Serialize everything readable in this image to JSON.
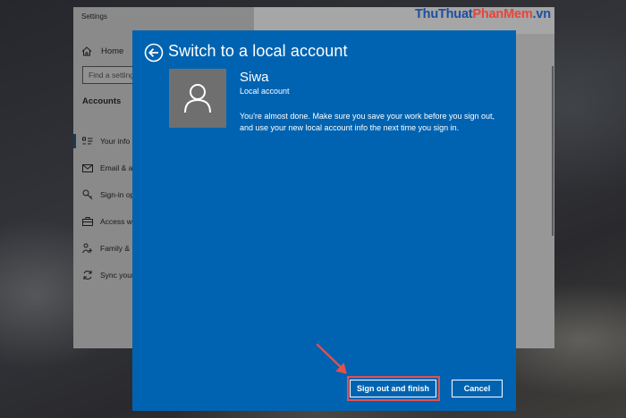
{
  "watermark": {
    "part1": "ThuThuat",
    "part2": "PhanMem",
    "part3": ".vn"
  },
  "settings": {
    "window_title": "Settings",
    "home_label": "Home",
    "search_placeholder": "Find a setting",
    "section_heading": "Accounts",
    "nav_items": [
      {
        "label": "Your info",
        "icon": "person-card-icon",
        "selected": true
      },
      {
        "label": "Email & a",
        "icon": "mail-icon",
        "selected": false
      },
      {
        "label": "Sign-in op",
        "icon": "key-icon",
        "selected": false
      },
      {
        "label": "Access w",
        "icon": "briefcase-icon",
        "selected": false
      },
      {
        "label": "Family &",
        "icon": "family-icon",
        "selected": false
      },
      {
        "label": "Sync your",
        "icon": "sync-icon",
        "selected": false
      }
    ]
  },
  "dialog": {
    "title": "Switch to a local account",
    "user_name": "Siwa",
    "account_type": "Local account",
    "message": "You're almost done. Make sure you save your work before you sign out, and use your new local account info the next time you sign in.",
    "primary_button": "Sign out and finish",
    "cancel_button": "Cancel",
    "colors": {
      "background": "#0063b1",
      "avatar": "#6f6f6f",
      "highlight": "#e0524f"
    }
  }
}
